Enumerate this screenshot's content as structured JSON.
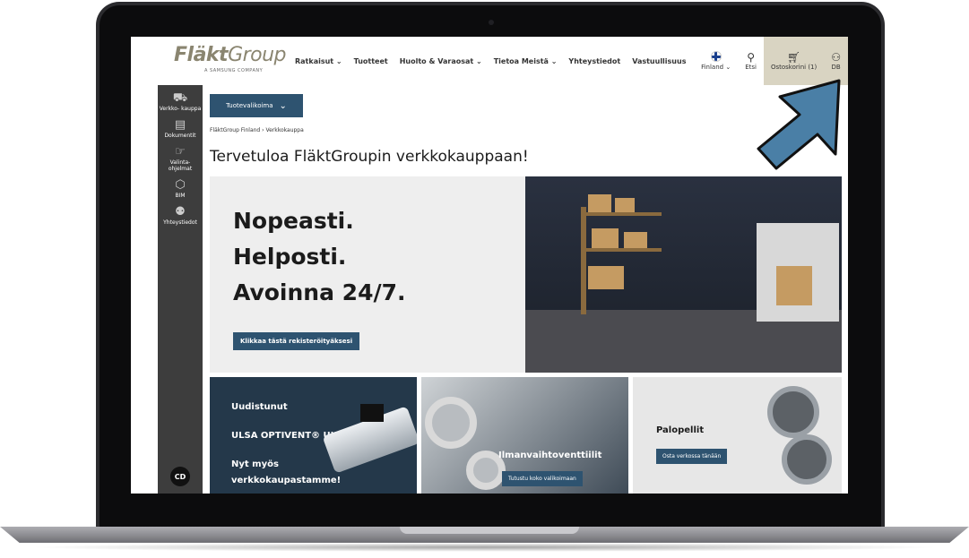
{
  "header": {
    "logo_main": "Fläkt",
    "logo_light": "Group",
    "logo_sub": "A SAMSUNG COMPANY",
    "nav": [
      "Ratkaisut ⌄",
      "Tuotteet",
      "Huolto & Varaosat ⌄",
      "Tietoa Meistä ⌄",
      "Yhteystiedot",
      "Vastuullisuus"
    ],
    "country": "Finland ⌄",
    "search": "Etsi",
    "cart": "Ostoskorini (1)",
    "user": "DB"
  },
  "sidebar": {
    "items": [
      {
        "icon": "cart-icon",
        "label": "Verkko- kauppa"
      },
      {
        "icon": "document-icon",
        "label": "Dokumentit"
      },
      {
        "icon": "select-tool-icon",
        "label": "Valinta- ohjelmat"
      },
      {
        "icon": "bim-cube-icon",
        "label": "BIM"
      },
      {
        "icon": "contacts-icon",
        "label": "Yhteystiedot"
      }
    ],
    "bottom_badge": "CD"
  },
  "main": {
    "category_button": "Tuotevalikoima",
    "breadcrumb": "FläktGroup Finland  ›  Verkkokauppa",
    "title": "Tervetuloa FläktGroupin verkkokauppaan!",
    "hero": {
      "lines": [
        "Nopeasti.",
        "Helposti.",
        "Avoinna 24/7."
      ],
      "button": "Klikkaa tästä rekisteröityäksesi"
    },
    "cards": [
      {
        "line1": "Uudistunut",
        "line2": "ULSA OPTIVENT® ULTRA",
        "line3": "Nyt myös",
        "line4": "verkkokaupastamme!"
      },
      {
        "title": "Ilmanvaihtoventtiilit",
        "button": "Tutustu koko valikoimaan"
      },
      {
        "title": "Palopellit",
        "button": "Osta verkossa tänään"
      }
    ]
  },
  "colors": {
    "accent": "#2e5370",
    "sidebar": "#3d3d3d",
    "cart_bg": "#d9d4c2",
    "arrow": "#4a7fa6"
  }
}
